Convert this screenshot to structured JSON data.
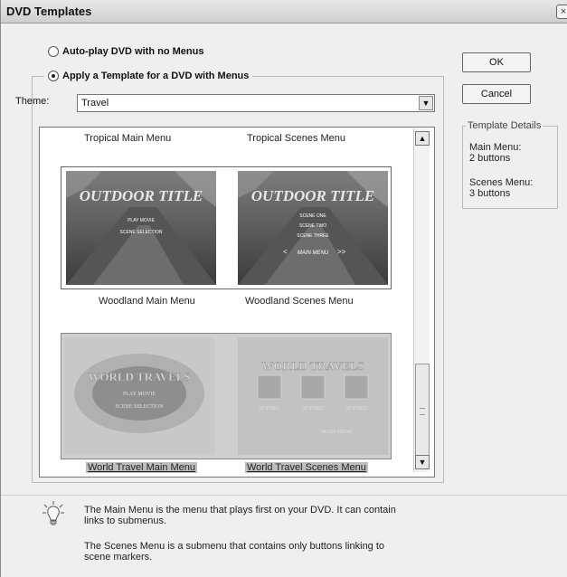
{
  "window": {
    "title": "DVD Templates"
  },
  "options": {
    "auto_play_label": "Auto-play DVD with no Menus",
    "apply_template_label": "Apply a Template for a DVD with Menus",
    "selected": "apply_template"
  },
  "theme": {
    "label": "Theme:",
    "value": "Travel"
  },
  "templates": [
    {
      "main": "Tropical Main Menu",
      "scenes": "Tropical Scenes Menu"
    },
    {
      "main": "Woodland Main Menu",
      "scenes": "Woodland Scenes Menu",
      "main_thumb": {
        "title": "OUTDOOR TITLE",
        "buttons": [
          "PLAY MOVIE",
          "SCENE SELECTION"
        ]
      },
      "scenes_thumb": {
        "title": "OUTDOOR TITLE",
        "buttons": [
          "SCENE ONE",
          "SCENE TWO",
          "SCENE THREE"
        ],
        "nav": "MAIN MENU"
      }
    },
    {
      "main": "World Travel Main Menu",
      "scenes": "World Travel Scenes Menu",
      "main_thumb": {
        "title": "WORLD TRAVELS",
        "buttons": [
          "PLAY MOVIE",
          "SCENE SELECTION"
        ]
      },
      "scenes_thumb": {
        "title": "WORLD TRAVELS",
        "buttons": [
          "SCENE1",
          "SCENE2",
          "SCENE3"
        ],
        "nav": "MAIN MENU"
      }
    }
  ],
  "buttons": {
    "ok": "OK",
    "cancel": "Cancel"
  },
  "details": {
    "legend": "Template Details",
    "main_label": "Main Menu:",
    "main_value": "2 buttons",
    "scenes_label": "Scenes Menu:",
    "scenes_value": "3 buttons"
  },
  "hint": {
    "line1": "The Main Menu is the menu that plays first on your DVD. It can contain",
    "line2": "links to submenus.",
    "line3": "The Scenes Menu is a submenu that contains only buttons linking to",
    "line4": "scene markers."
  },
  "icons": [
    "lightbulb-icon",
    "close-icon",
    "dropdown-arrow-icon",
    "scroll-up-icon",
    "scroll-down-icon"
  ]
}
